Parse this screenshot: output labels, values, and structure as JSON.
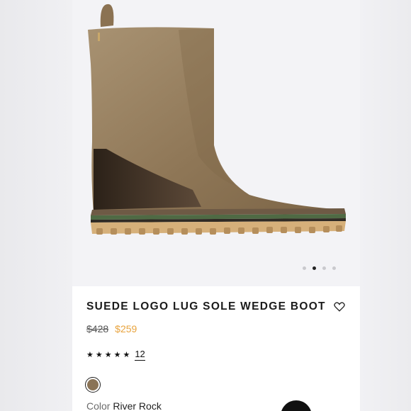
{
  "product": {
    "title": "SUEDE LOGO LUG SOLE WEDGE BOOT",
    "original_price": "$428",
    "sale_price": "$259",
    "rating_stars": "★★★★★",
    "review_count": "12",
    "color_label": "Color",
    "color_name": "River Rock",
    "swatch_color": "#8a7356"
  },
  "gallery": {
    "image_count": 4,
    "active_index": 1
  },
  "colors": {
    "sale_price": "#e8a33d",
    "accent_dark": "#111111"
  },
  "icons": {
    "favorite": "heart-outline-icon",
    "rating": "star-icon"
  }
}
